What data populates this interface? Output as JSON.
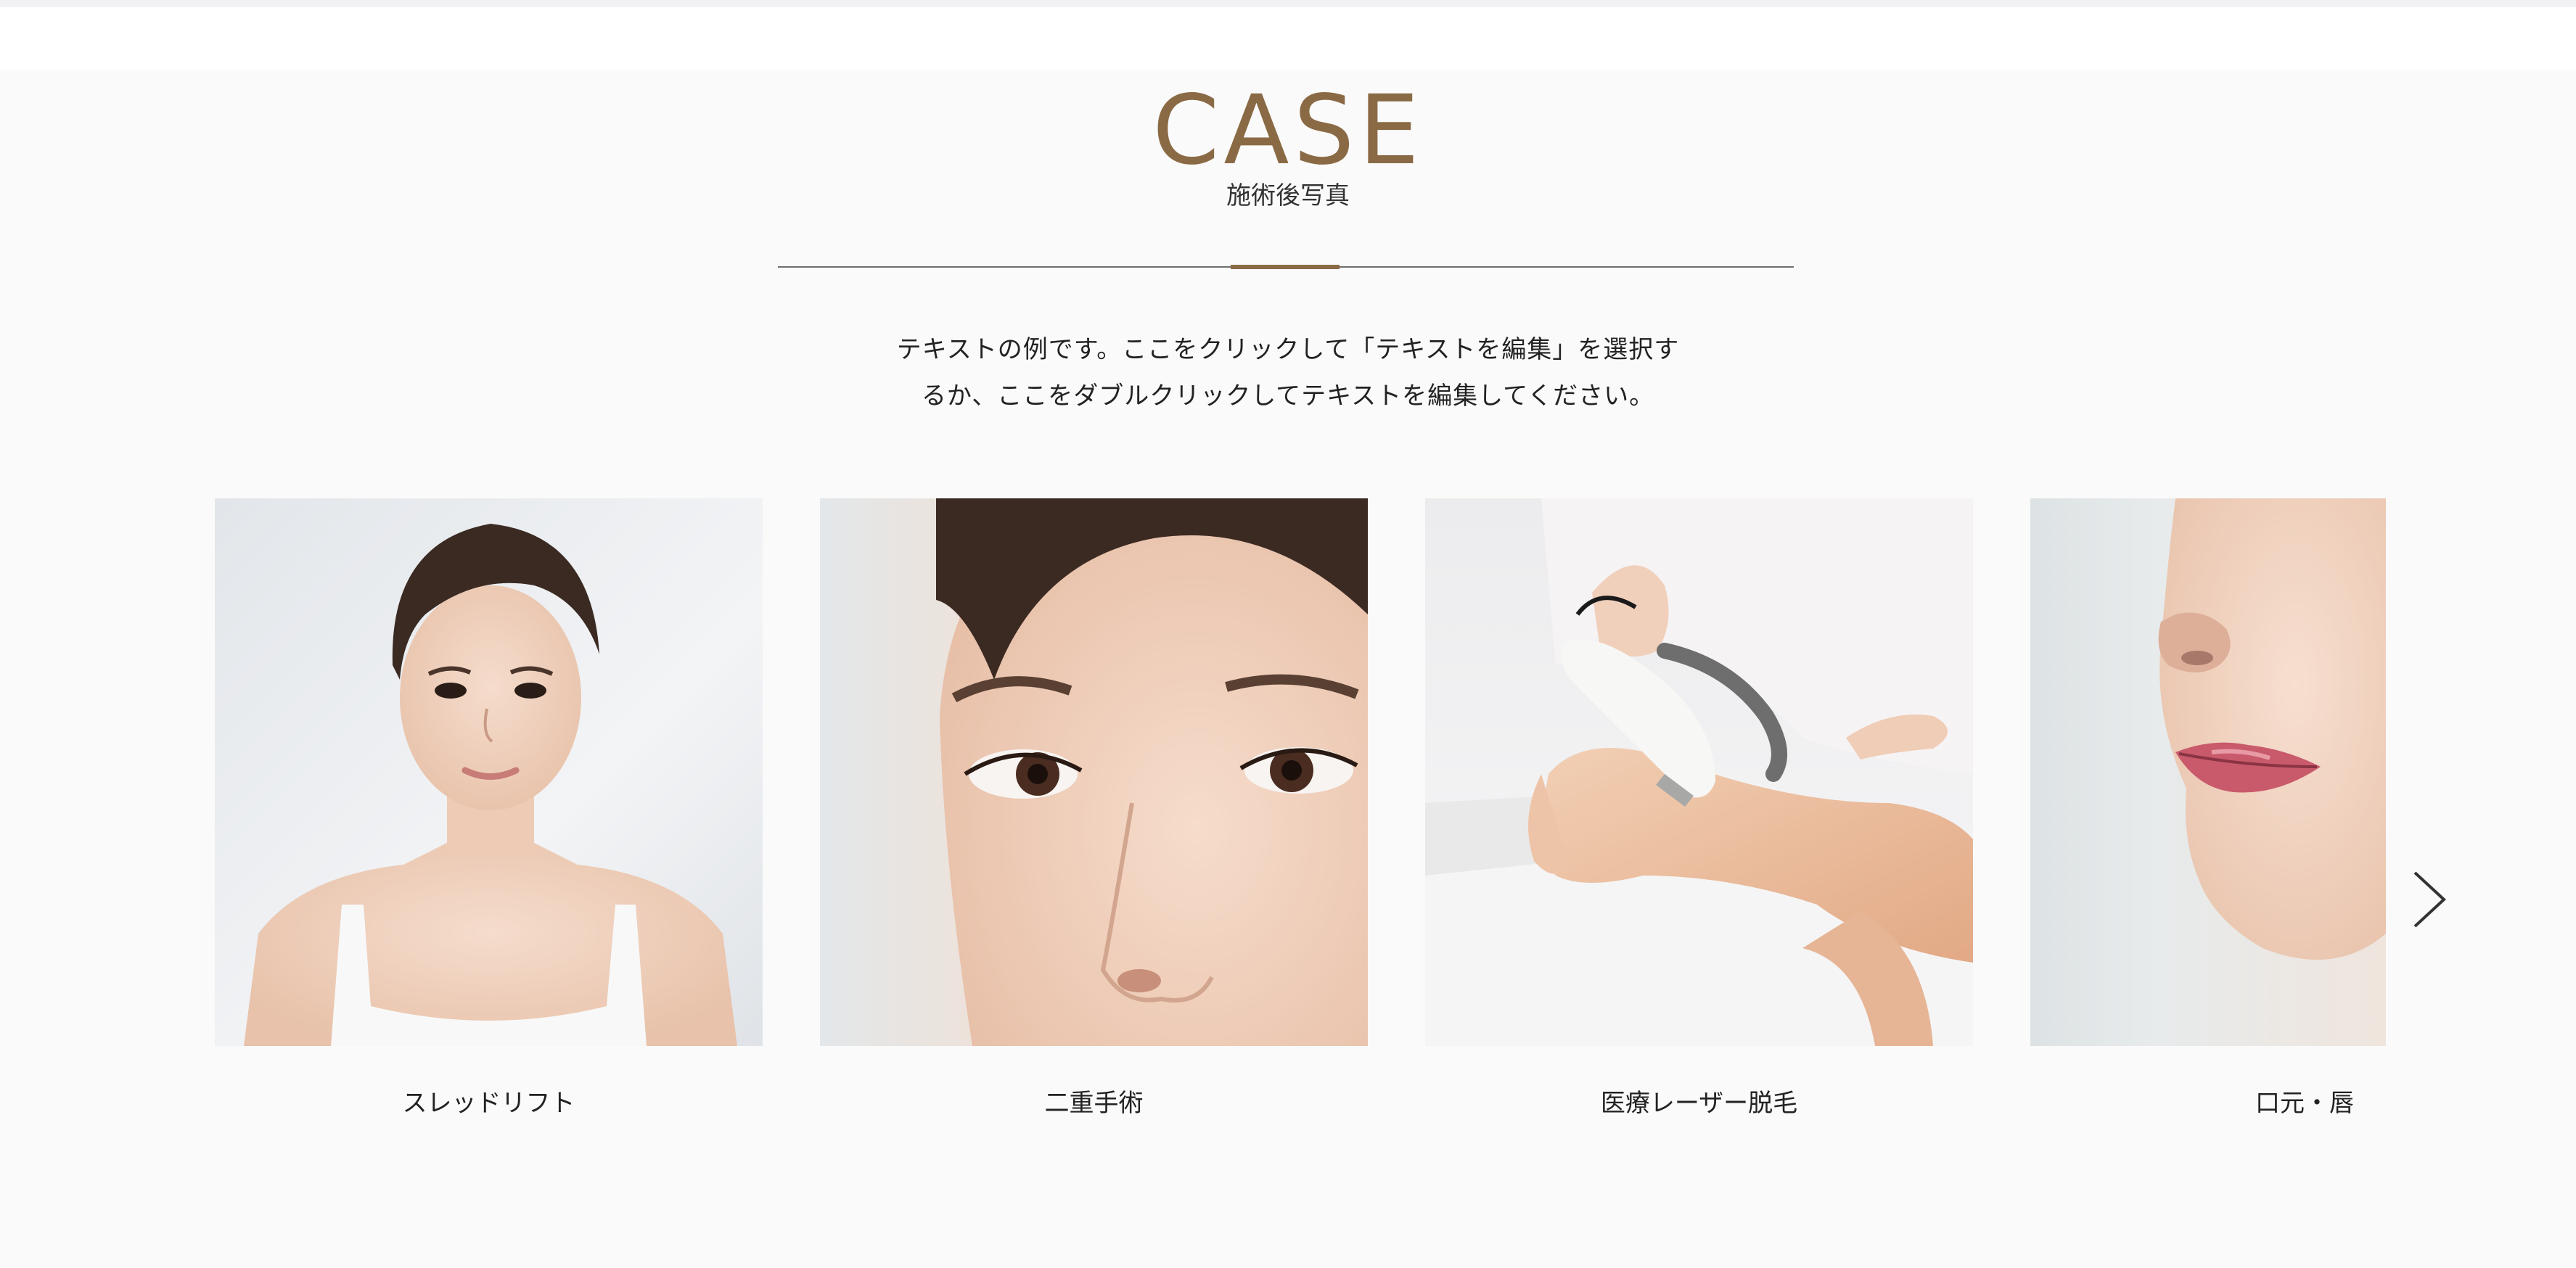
{
  "section": {
    "title": "CASE",
    "subtitle": "施術後写真",
    "description_line1": "テキストの例です。ここをクリックして「テキストを編集」を選択す",
    "description_line2": "るか、ここをダブルクリックしてテキストを編集してください。"
  },
  "colors": {
    "accent": "#8a6a45",
    "background": "#fafafa",
    "text": "#222222"
  },
  "carousel": {
    "items": [
      {
        "label": "スレッドリフト",
        "image": "portrait of woman in white tank top"
      },
      {
        "label": "二重手術",
        "image": "close-up of woman's eyes"
      },
      {
        "label": "医療レーザー脱毛",
        "image": "laser hair removal on leg"
      },
      {
        "label": "口元・唇",
        "image": "close-up of lips and nose"
      }
    ],
    "next_icon": "chevron-right-icon"
  }
}
